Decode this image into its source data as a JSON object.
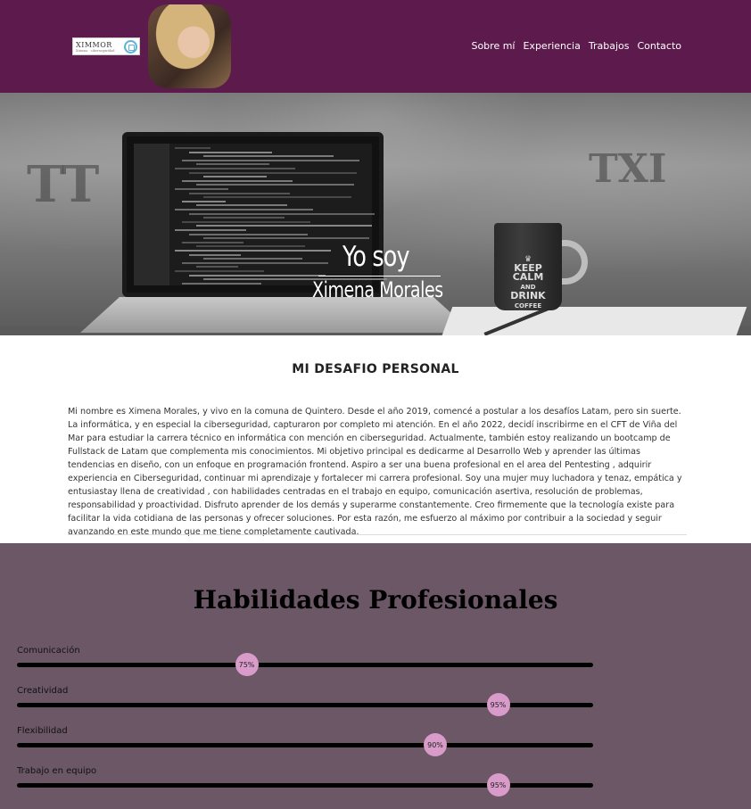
{
  "header": {
    "logo_text": "XIMMOR",
    "logo_subtitle": "Ximena · ciberseguridad",
    "nav": [
      "Sobre mí",
      "Experiencia",
      "Trabajos",
      "Contacto"
    ]
  },
  "hero": {
    "title": "Yo soy",
    "name": "Ximena Morales",
    "mug_text_lines": [
      "KEEP",
      "CALM",
      "AND",
      "DRINK",
      "COFFEE"
    ]
  },
  "about": {
    "title": "MI DESAFIO PERSONAL",
    "text": "Mi nombre es Ximena Morales, y vivo en la comuna de Quintero. Desde el año 2019, comencé a postular a los desafíos Latam, pero sin suerte. La informática, y en especial la ciberseguridad, capturaron por completo mi atención. En el año 2022, decidí inscribirme en el CFT de Viña del Mar para estudiar la carrera técnico en informática con mención en ciberseguridad. Actualmente, también estoy realizando un bootcamp de Fullstack de Latam que complementa mis conocimientos. Mi objetivo principal es dedicarme al Desarrollo Web y aprender las últimas tendencias en diseño, con un enfoque en programación frontend. Aspiro a ser una buena profesional en el area del Pentesting , adquirir experiencia en Ciberseguridad, continuar mi aprendizaje y fortalecer mi carrera profesional. Soy una mujer muy luchadora y tenaz, empática y entusiastay llena de creatividad , con habilidades centradas en el trabajo en equipo, comunicación asertiva, resolución de problemas, responsabilidad y proactividad. Disfruto aprender de los demás y superarme constantemente. Creo firmemente que la tecnología existe para facilitar la vida cotidiana de las personas y ofrecer soluciones. Por esta razón, me esfuerzo al máximo por contribuir a la sociedad y seguir avanzando en este mundo que me tiene completamente cautivada."
  },
  "skills": {
    "title": "Habilidades Profesionales",
    "items": [
      {
        "label": "Comunicación",
        "value_label": "75%",
        "value": 0.75
      },
      {
        "label": "Creatividad",
        "value_label": "95%",
        "value": 0.95
      },
      {
        "label": "Flexibilidad",
        "value_label": "90%",
        "value": 0.9
      },
      {
        "label": "Trabajo en equipo",
        "value_label": "95%",
        "value": 0.95
      }
    ]
  },
  "colors": {
    "header_bg": "#5c1a4d",
    "skills_bg": "#6b5766",
    "knob": "#d99bc9"
  }
}
